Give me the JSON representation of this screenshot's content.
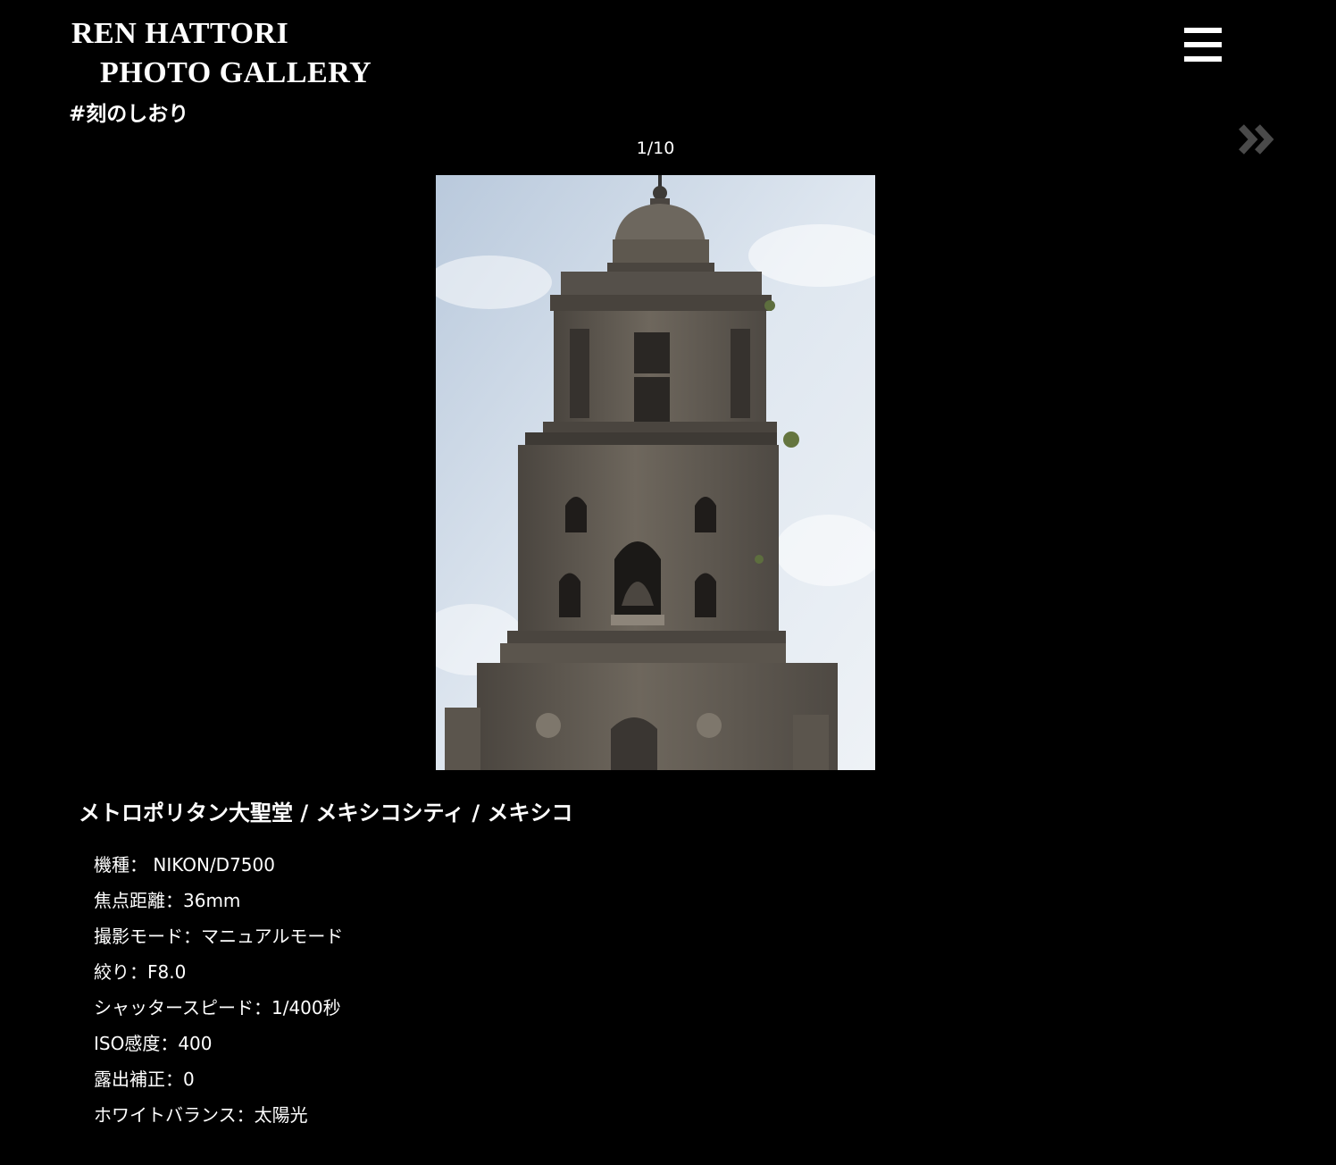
{
  "header": {
    "logo_line1": "REN HATTORI",
    "logo_line2": "PHOTO GALLERY",
    "tagline": "#刻のしおり",
    "menu_icon": "hamburger-menu-icon",
    "next_icon": "double-chevron-right-icon",
    "next_icon_color": "#4a4a4a"
  },
  "gallery": {
    "counter": "1/10",
    "photo_subject": "bell-tower-photo"
  },
  "caption": {
    "title": "メトロポリタン大聖堂 / メキシコシティ / メキシコ"
  },
  "specs": [
    "機種： NIKON/D7500",
    "焦点距離：36mm",
    "撮影モード：マニュアルモード",
    "絞り：F8.0",
    "シャッタースピード：1/400秒",
    "ISO感度：400",
    "露出補正：0",
    "ホワイトバランス：太陽光"
  ],
  "colors": {
    "background": "#000000",
    "text": "#ffffff"
  }
}
